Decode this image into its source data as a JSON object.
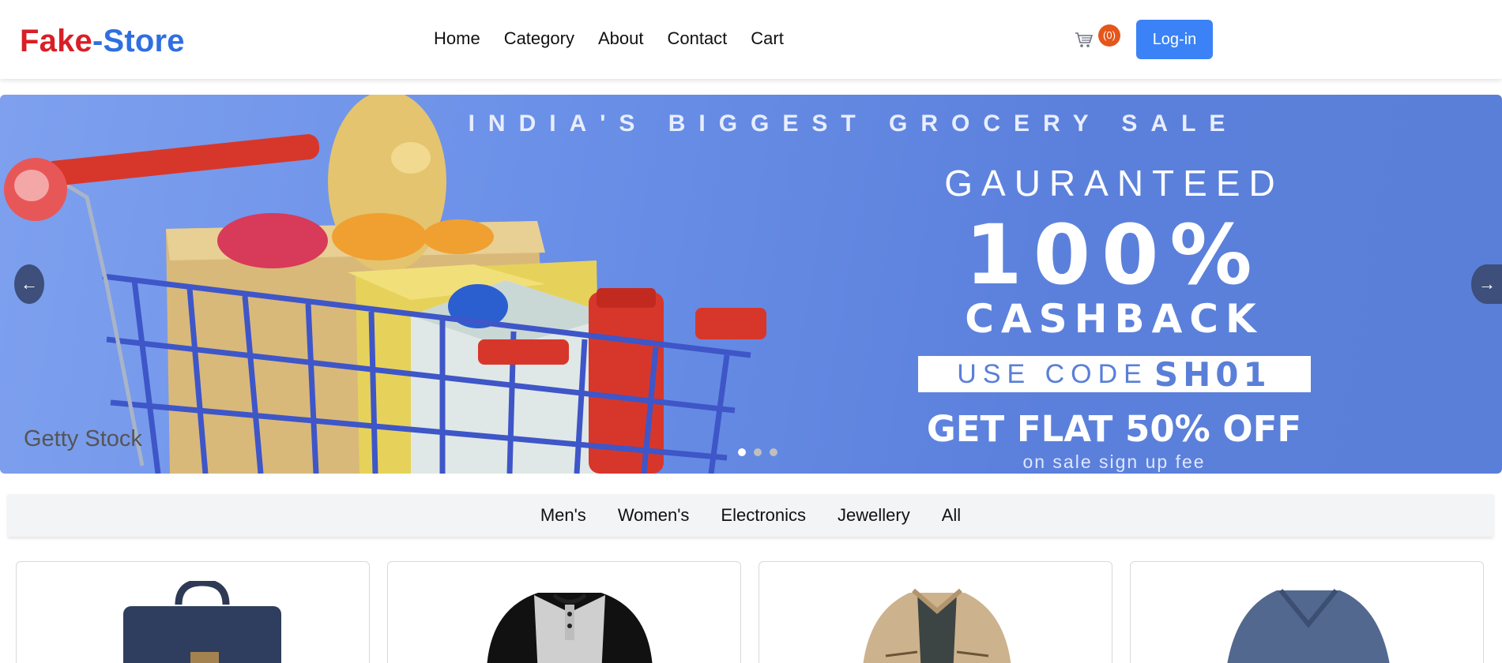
{
  "header": {
    "logo_part1": "Fake",
    "logo_part2": "-Store",
    "nav": [
      "Home",
      "Category",
      "About",
      "Contact",
      "Cart"
    ],
    "cart_count": "(0)",
    "login_label": "Log-in"
  },
  "banner": {
    "top_text": "INDIA'S BIGGEST GROCERY SALE",
    "guaranteed": "GAURANTEED",
    "percent": "100%",
    "cashback": "CASHBACK",
    "code_label": "USE CODE",
    "code_value": "SH01",
    "flat": "GET FLAT 50% OFF",
    "sub": "on sale sign up fee",
    "watermark": "Getty Stock",
    "prev_label": "←",
    "next_label": "→",
    "active_slide": 1,
    "slide_count": 3
  },
  "categories": [
    "Men's",
    "Women's",
    "Electronics",
    "Jewellery",
    "All"
  ],
  "products": [
    {
      "image": "backpack-image"
    },
    {
      "image": "raglan-shirt-image"
    },
    {
      "image": "jacket-image"
    },
    {
      "image": "vneck-tee-image"
    }
  ],
  "colors": {
    "logo_red": "#d91f26",
    "logo_blue": "#2f6fe0",
    "button_blue": "#3b82f6",
    "badge_orange": "#e4561a",
    "banner_blue": "#5b80dc"
  }
}
